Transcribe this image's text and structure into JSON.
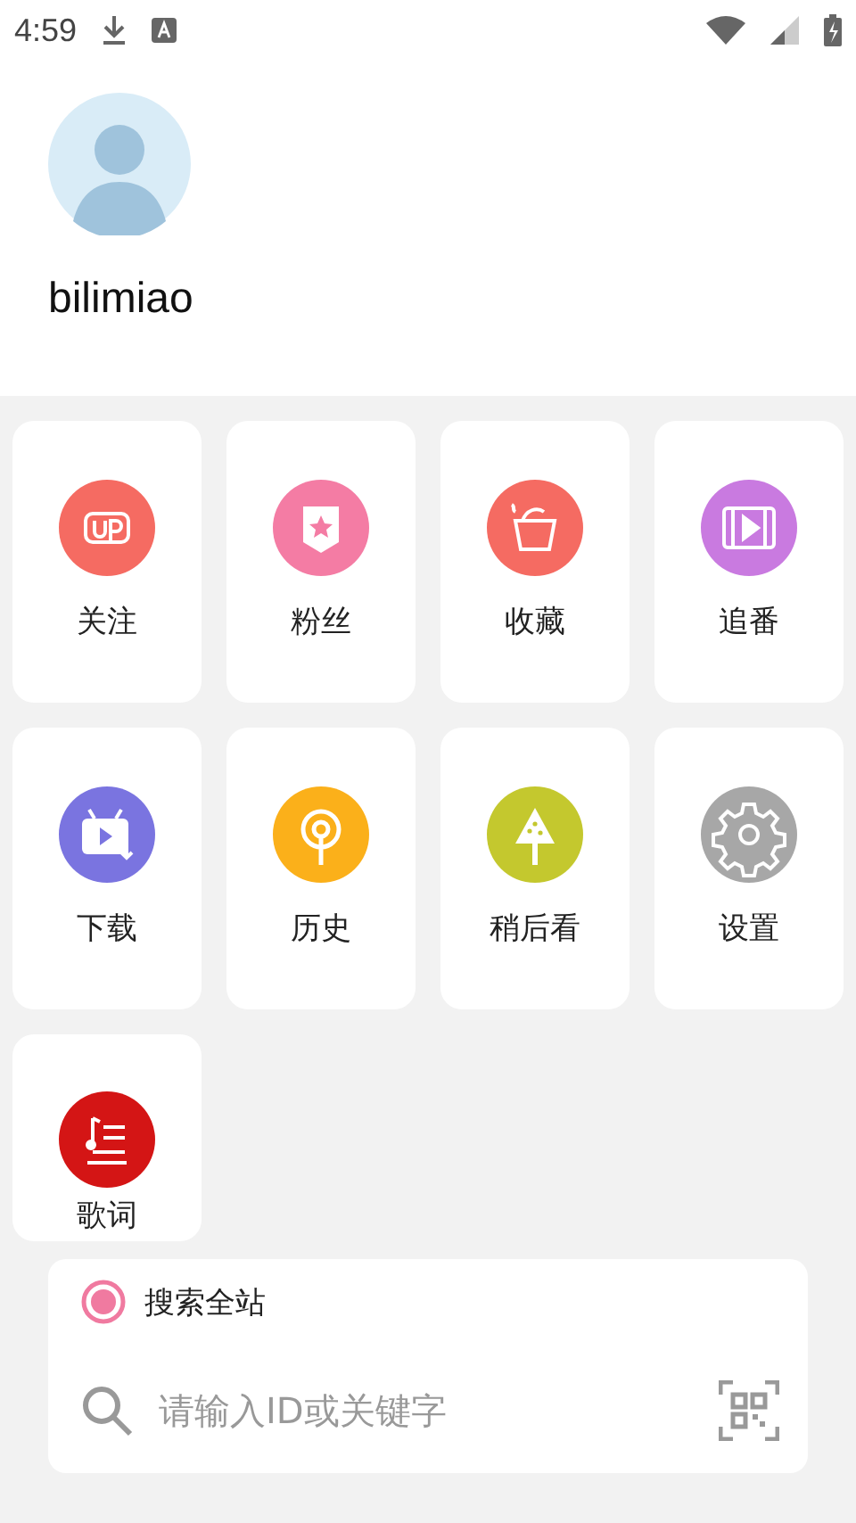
{
  "status_bar": {
    "time": "4:59"
  },
  "profile": {
    "name": "bilimiao"
  },
  "menu": [
    {
      "label": "关注"
    },
    {
      "label": "粉丝"
    },
    {
      "label": "收藏"
    },
    {
      "label": "追番"
    },
    {
      "label": "下载"
    },
    {
      "label": "历史"
    },
    {
      "label": "稍后看"
    },
    {
      "label": "设置"
    },
    {
      "label": "歌词"
    }
  ],
  "search": {
    "scope": {
      "label": "搜索全站",
      "selected": true
    },
    "placeholder": "请输入ID或关键字"
  }
}
